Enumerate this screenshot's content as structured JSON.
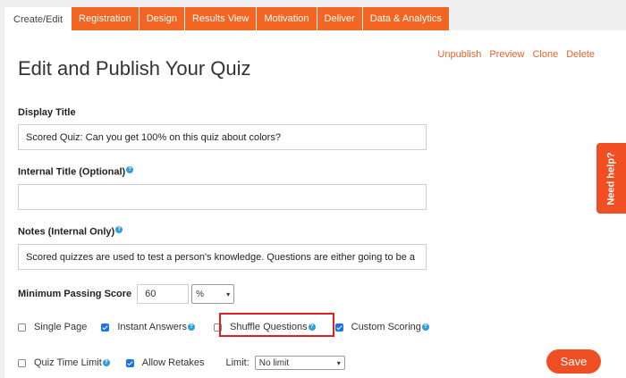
{
  "tabs": [
    "Create/Edit",
    "Registration",
    "Design",
    "Results View",
    "Motivation",
    "Deliver",
    "Data & Analytics"
  ],
  "page_title": "Edit and Publish Your Quiz",
  "actions": [
    "Unpublish",
    "Preview",
    "Clone",
    "Delete"
  ],
  "display_title": {
    "label": "Display Title",
    "value": "Scored Quiz: Can you get 100% on this quiz about colors?"
  },
  "internal_title": {
    "label": "Internal Title (Optional)",
    "value": ""
  },
  "notes": {
    "label": "Notes (Internal Only)",
    "value": "Scored quizzes are used to test a person's knowledge. Questions are either going to be a"
  },
  "min_score": {
    "label": "Minimum Passing Score",
    "value": "60",
    "unit": "%"
  },
  "options_row1": [
    {
      "label": "Single Page",
      "checked": false,
      "help": false
    },
    {
      "label": "Instant Answers",
      "checked": true,
      "help": true
    },
    {
      "label": "Shuffle Questions",
      "checked": false,
      "help": true
    },
    {
      "label": "Custom Scoring",
      "checked": true,
      "help": true
    }
  ],
  "options_row2": {
    "quiz_time_limit": {
      "label": "Quiz Time Limit",
      "checked": false
    },
    "allow_retakes": {
      "label": "Allow Retakes",
      "checked": true
    },
    "limit_label": "Limit:",
    "limit_value": "No limit"
  },
  "save_label": "Save",
  "need_help_label": "Need help?",
  "help_glyph": "?",
  "colors": {
    "accent": "#f26522",
    "checkbox": "#1a73e8",
    "help": "#2e9fd8",
    "highlight": "#e02020"
  }
}
